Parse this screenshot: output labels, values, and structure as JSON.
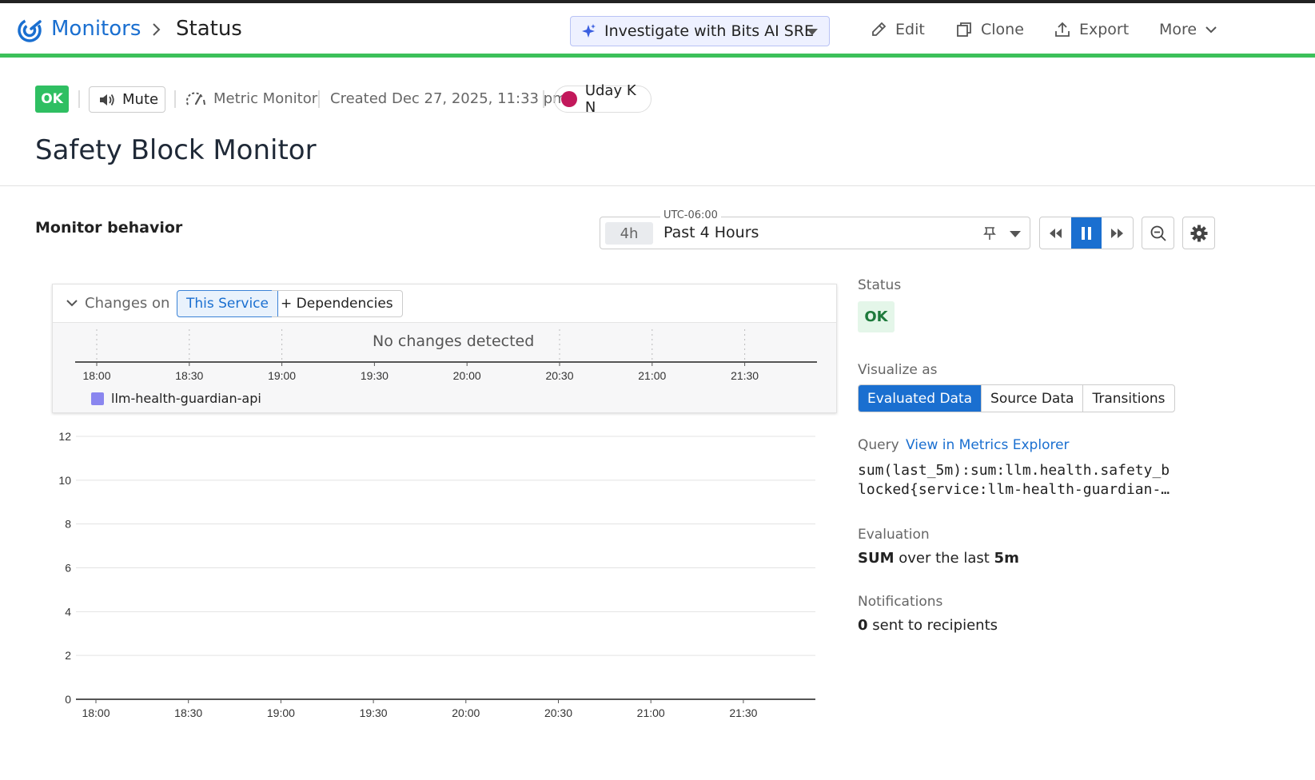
{
  "breadcrumb": {
    "root": "Monitors",
    "current": "Status"
  },
  "header": {
    "bits_button": "Investigate with Bits AI SRE",
    "actions": {
      "edit": "Edit",
      "clone": "Clone",
      "export": "Export",
      "more": "More"
    }
  },
  "monitor": {
    "state": "OK",
    "mute_label": "Mute",
    "type": "Metric Monitor",
    "created": "Created Dec 27, 2025, 11:33 pm",
    "owner": "Uday K N",
    "title": "Safety Block Monitor"
  },
  "behavior": {
    "section_title": "Monitor behavior",
    "timezone": "UTC-06:00",
    "range_chip": "4h",
    "range_label": "Past 4 Hours"
  },
  "changes": {
    "title": "Changes on",
    "this_service": "This Service",
    "dependencies": "+ Dependencies",
    "empty_text": "No changes detected",
    "legend": "llm-health-guardian-api",
    "legend_color": "#8a86ef",
    "time_ticks": [
      "18:00",
      "18:30",
      "19:00",
      "19:30",
      "20:00",
      "20:30",
      "21:00",
      "21:30"
    ]
  },
  "chart_data": {
    "type": "line",
    "x": [
      "18:00",
      "18:30",
      "19:00",
      "19:30",
      "20:00",
      "20:30",
      "21:00",
      "21:30"
    ],
    "series": [],
    "yticks": [
      0,
      2,
      4,
      6,
      8,
      10,
      12
    ],
    "ylim": [
      0,
      12
    ],
    "xlabel": "",
    "ylabel": ""
  },
  "details": {
    "status_label": "Status",
    "status_value": "OK",
    "visualize_label": "Visualize as",
    "visualize_options": [
      "Evaluated Data",
      "Source Data",
      "Transitions"
    ],
    "query_label": "Query",
    "query_link": "View in Metrics Explorer",
    "query_text": "sum(last_5m):sum:llm.health.safety_blocked{service:llm-health-guardian-…",
    "evaluation_label": "Evaluation",
    "evaluation_agg": "SUM",
    "evaluation_mid": " over the last ",
    "evaluation_window": "5m",
    "notifications_label": "Notifications",
    "notifications_count": "0",
    "notifications_text": " sent to recipients"
  },
  "colors": {
    "accent": "#1a6fd0",
    "ok_green": "#2fbf62",
    "status_bar": "#3cc05a"
  }
}
